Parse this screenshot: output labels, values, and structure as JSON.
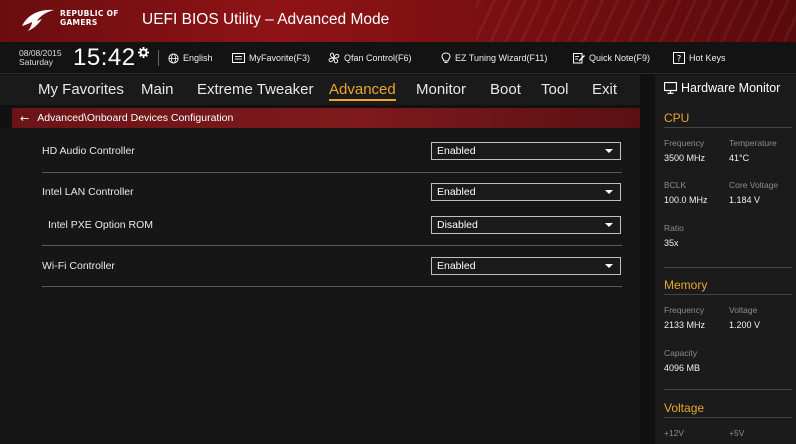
{
  "titlebar": {
    "brand_line1": "REPUBLIC OF",
    "brand_line2": "GAMERS",
    "title": "UEFI BIOS Utility – Advanced Mode",
    "accent_color": "#8f1316"
  },
  "toolbar": {
    "date": "08/08/2015",
    "day": "Saturday",
    "time": "15:42",
    "language": "English",
    "myfavorite": "MyFavorite(F3)",
    "qfan": "Qfan Control(F6)",
    "ez_tuning": "EZ Tuning Wizard(F11)",
    "quick_note": "Quick Note(F9)",
    "hot_keys": "Hot Keys",
    "icons": [
      "gear-icon",
      "globe-icon",
      "favorite-icon",
      "fan-icon",
      "bulb-icon",
      "note-icon",
      "help-icon"
    ]
  },
  "nav": {
    "tabs": [
      "My Favorites",
      "Main",
      "Extreme Tweaker",
      "Advanced",
      "Monitor",
      "Boot",
      "Tool",
      "Exit"
    ],
    "active": "Advanced",
    "active_color": "#e9a72a"
  },
  "breadcrumb": {
    "path": "Advanced\\Onboard Devices Configuration"
  },
  "settings": [
    {
      "label": "HD Audio Controller",
      "value": "Enabled"
    },
    {
      "label": "Intel LAN Controller",
      "value": "Enabled"
    },
    {
      "label": "Intel PXE Option ROM",
      "value": "Disabled"
    },
    {
      "label": "Wi-Fi Controller",
      "value": "Enabled"
    }
  ],
  "hw_monitor": {
    "title": "Hardware Monitor",
    "cpu": {
      "title": "CPU",
      "frequency_label": "Frequency",
      "frequency": "3500 MHz",
      "temperature_label": "Temperature",
      "temperature": "41°C",
      "bclk_label": "BCLK",
      "bclk": "100.0 MHz",
      "core_voltage_label": "Core Voltage",
      "core_voltage": "1.184 V",
      "ratio_label": "Ratio",
      "ratio": "35x"
    },
    "memory": {
      "title": "Memory",
      "frequency_label": "Frequency",
      "frequency": "2133 MHz",
      "voltage_label": "Voltage",
      "voltage": "1.200 V",
      "capacity_label": "Capacity",
      "capacity": "4096 MB"
    },
    "voltage": {
      "title": "Voltage",
      "v12_label": "+12V",
      "v5_label": "+5V"
    }
  }
}
